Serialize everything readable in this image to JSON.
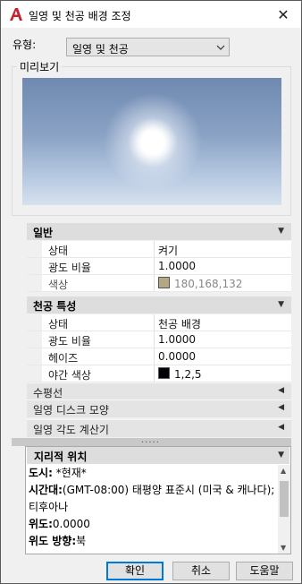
{
  "window": {
    "title": "일영 및 천공 배경 조정",
    "close_glyph": "✕"
  },
  "type_field": {
    "label": "유형:",
    "selected": "일영 및 천공"
  },
  "preview": {
    "label": "미리보기"
  },
  "sections": {
    "general": {
      "title": "일반",
      "rows": [
        {
          "name": "상태",
          "value": "켜기"
        },
        {
          "name": "광도 비율",
          "value": "1.0000"
        },
        {
          "name": "색상",
          "value": "180,168,132",
          "swatch": "#b4a884"
        }
      ]
    },
    "sky": {
      "title": "천공 특성",
      "rows": [
        {
          "name": "상태",
          "value": "천공 배경"
        },
        {
          "name": "광도 비율",
          "value": "1.0000"
        },
        {
          "name": "헤이즈",
          "value": "0.0000"
        },
        {
          "name": "야간 색상",
          "value": "1,2,5",
          "swatch": "#010205"
        }
      ]
    },
    "horizon": {
      "title": "수평선"
    },
    "sun_disk": {
      "title": "일영 디스크 모양"
    },
    "sun_angle": {
      "title": "일영 각도 계산기"
    }
  },
  "splitter": {
    "grip": "....."
  },
  "geo": {
    "title": "지리적 위치",
    "city_label": "도시:",
    "city_value": " *현재*",
    "timezone_label": "시간대:",
    "timezone_value": "(GMT-08:00) 태평양 표준시 (미국 & 캐나다); 티후아나",
    "lat_label": "위도:",
    "lat_value": "0.0000",
    "lat_dir_label": "위도 방향:",
    "lat_dir_value": "북"
  },
  "buttons": {
    "ok": "확인",
    "cancel": "취소",
    "help": "도움말"
  },
  "colors": {
    "accent": "#0078d7",
    "app_icon": "#c8202f"
  }
}
